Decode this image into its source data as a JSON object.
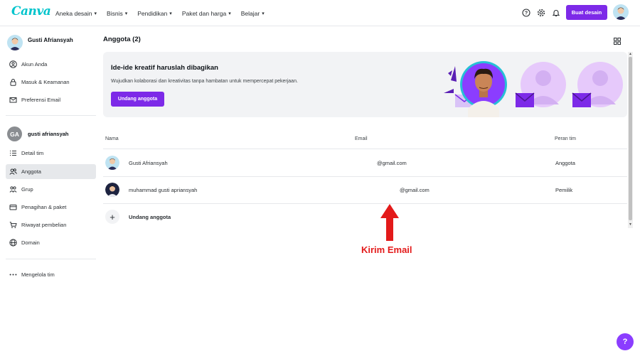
{
  "topbar": {
    "logo": "Canva",
    "nav": [
      "Aneka desain",
      "Bisnis",
      "Pendidikan",
      "Paket dan harga",
      "Belajar"
    ],
    "create_button": "Buat desain"
  },
  "sidebar": {
    "user_name": "Gusti Afriansyah",
    "account_items": [
      "Akun Anda",
      "Masuk & Keamanan",
      "Preferensi Email"
    ],
    "team_initials": "GA",
    "team_name": "gusti afriansyah",
    "team_items": [
      "Detail tim",
      "Anggota",
      "Grup",
      "Penagihan & paket",
      "Riwayat pembelian",
      "Domain"
    ],
    "manage_label": "Mengelola tim"
  },
  "main": {
    "title": "Anggota (2)",
    "banner": {
      "title": "Ide-ide kreatif haruslah dibagikan",
      "subtitle": "Wujudkan kolaborasi dan kreativitas tanpa hambatan untuk mempercepat pekerjaan.",
      "button": "Undang anggota"
    },
    "table": {
      "headers": [
        "Nama",
        "Email",
        "Peran tim"
      ],
      "rows": [
        {
          "name": "Gusti Afriansyah",
          "email": "@gmail.com",
          "role": "Anggota"
        },
        {
          "name": "muhammad gusti apriansyah",
          "email": "@gmail.com",
          "role": "Pemilik"
        }
      ],
      "invite_label": "Undang anggota"
    }
  },
  "annotation": {
    "text": "Kirim Email",
    "color": "#e31a1a"
  },
  "help_label": "?",
  "colors": {
    "accent": "#7d2ae8",
    "brand": "#00c4cc"
  }
}
